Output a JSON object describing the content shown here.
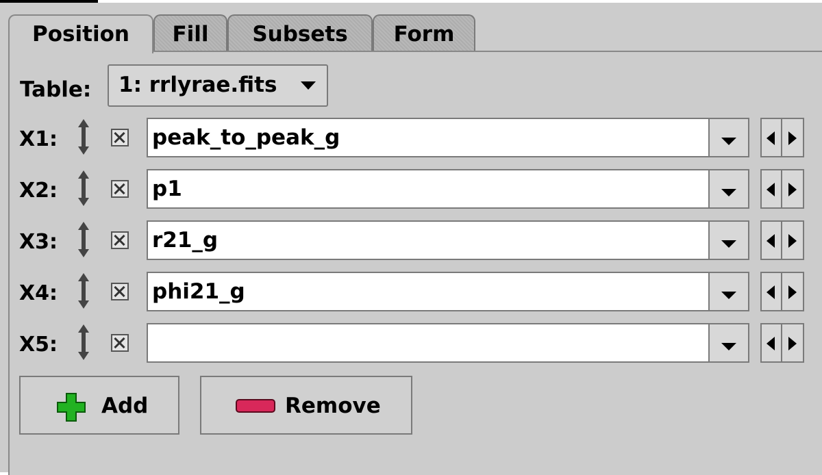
{
  "tabs": [
    {
      "label": "Position",
      "selected": true
    },
    {
      "label": "Fill",
      "selected": false
    },
    {
      "label": "Subsets",
      "selected": false
    },
    {
      "label": "Form",
      "selected": false
    }
  ],
  "table": {
    "label": "Table:",
    "selected": "1: rrlyrae.fits"
  },
  "rows": [
    {
      "label": "X1:",
      "value": "peak_to_peak_g",
      "checked": true
    },
    {
      "label": "X2:",
      "value": "p1",
      "checked": true
    },
    {
      "label": "X3:",
      "value": "r21_g",
      "checked": true
    },
    {
      "label": "X4:",
      "value": "phi21_g",
      "checked": true
    },
    {
      "label": "X5:",
      "value": "",
      "checked": true
    }
  ],
  "buttons": {
    "add": "Add",
    "remove": "Remove"
  },
  "icons": {
    "updown": "up-down-arrow-icon",
    "add": "green-plus-icon",
    "remove": "red-minus-icon",
    "dropdown": "chevron-down-icon",
    "left": "arrow-left-icon",
    "right": "arrow-right-icon"
  },
  "colors": {
    "background": "#cccccc",
    "field": "#ffffff",
    "add_icon": "#22b222",
    "remove_icon": "#d8285a"
  }
}
